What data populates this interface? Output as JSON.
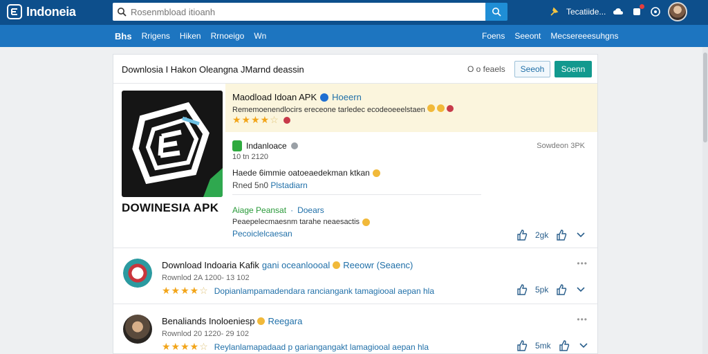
{
  "header": {
    "brand": "Indoneia",
    "search_placeholder": "Rosenmbload itioanh",
    "user_link": "Tecatiide..."
  },
  "subnav": {
    "left": [
      "Bhs",
      "Rrigens",
      "Hiken",
      "Rrnoeigo",
      "Wn"
    ],
    "right": [
      "Foens",
      "Seeont",
      "Mecsereeesuhgns"
    ]
  },
  "toolbar": {
    "title": "Downlosia I Hakon Oleangna  JMarnd deassin",
    "sort_label": "O o feaels",
    "btn_outline": "Seeoh",
    "btn_solid": "Soenn"
  },
  "featured": {
    "app_caption": "DOWINESIA APK",
    "title": "Maodload Idoan APK",
    "title_link": "Hoeern",
    "description": "Rememoenendlocirs ereceone tarledec ecodeoeeelstaen",
    "rating_stars": "3.5 of 5",
    "sub": {
      "name": "Indanloace",
      "meta": "10 tn 2120",
      "date": "Sowdeon 3PK",
      "line1": "Haede 6immie oatoeaedekman ktkan",
      "line2_prefix": "Rned 5n0",
      "line2_link": "Plstadiarn",
      "line3_green": "Aiage Peansat",
      "line3_blue": "Doears",
      "line4": "Peaepelecmaesnm tarahe neaesactis",
      "line5": "Pecoiclelcaesan",
      "like_count": "2gk"
    }
  },
  "rows": [
    {
      "title": "Download Indoaria Kafik",
      "title_link": "gani oceanloooal",
      "tag": "Reeowr (Seaenc)",
      "meta": "Rownlod 2A 1200- 13 102",
      "rating_stars": "4 of 5",
      "rating_link": "Dopianlampamadendara ranciangank tamagiooal aepan hla",
      "like_count": "5pk"
    },
    {
      "title": "Benaliands Inoloeniesp",
      "title_link": "Reegara",
      "meta": "Rownlod 20 1220- 29 102",
      "rating_stars": "4 of 5",
      "rating_link": "Reylanlamapadaad p gariangangakt lamagiooal aepan hla",
      "like_count": "5mk"
    }
  ],
  "colors": {
    "header_bg": "#0d4f8c",
    "subnav_bg": "#1d75c0",
    "accent_teal": "#12998e",
    "link_blue": "#1f6fa8",
    "star": "#f2a51a"
  }
}
